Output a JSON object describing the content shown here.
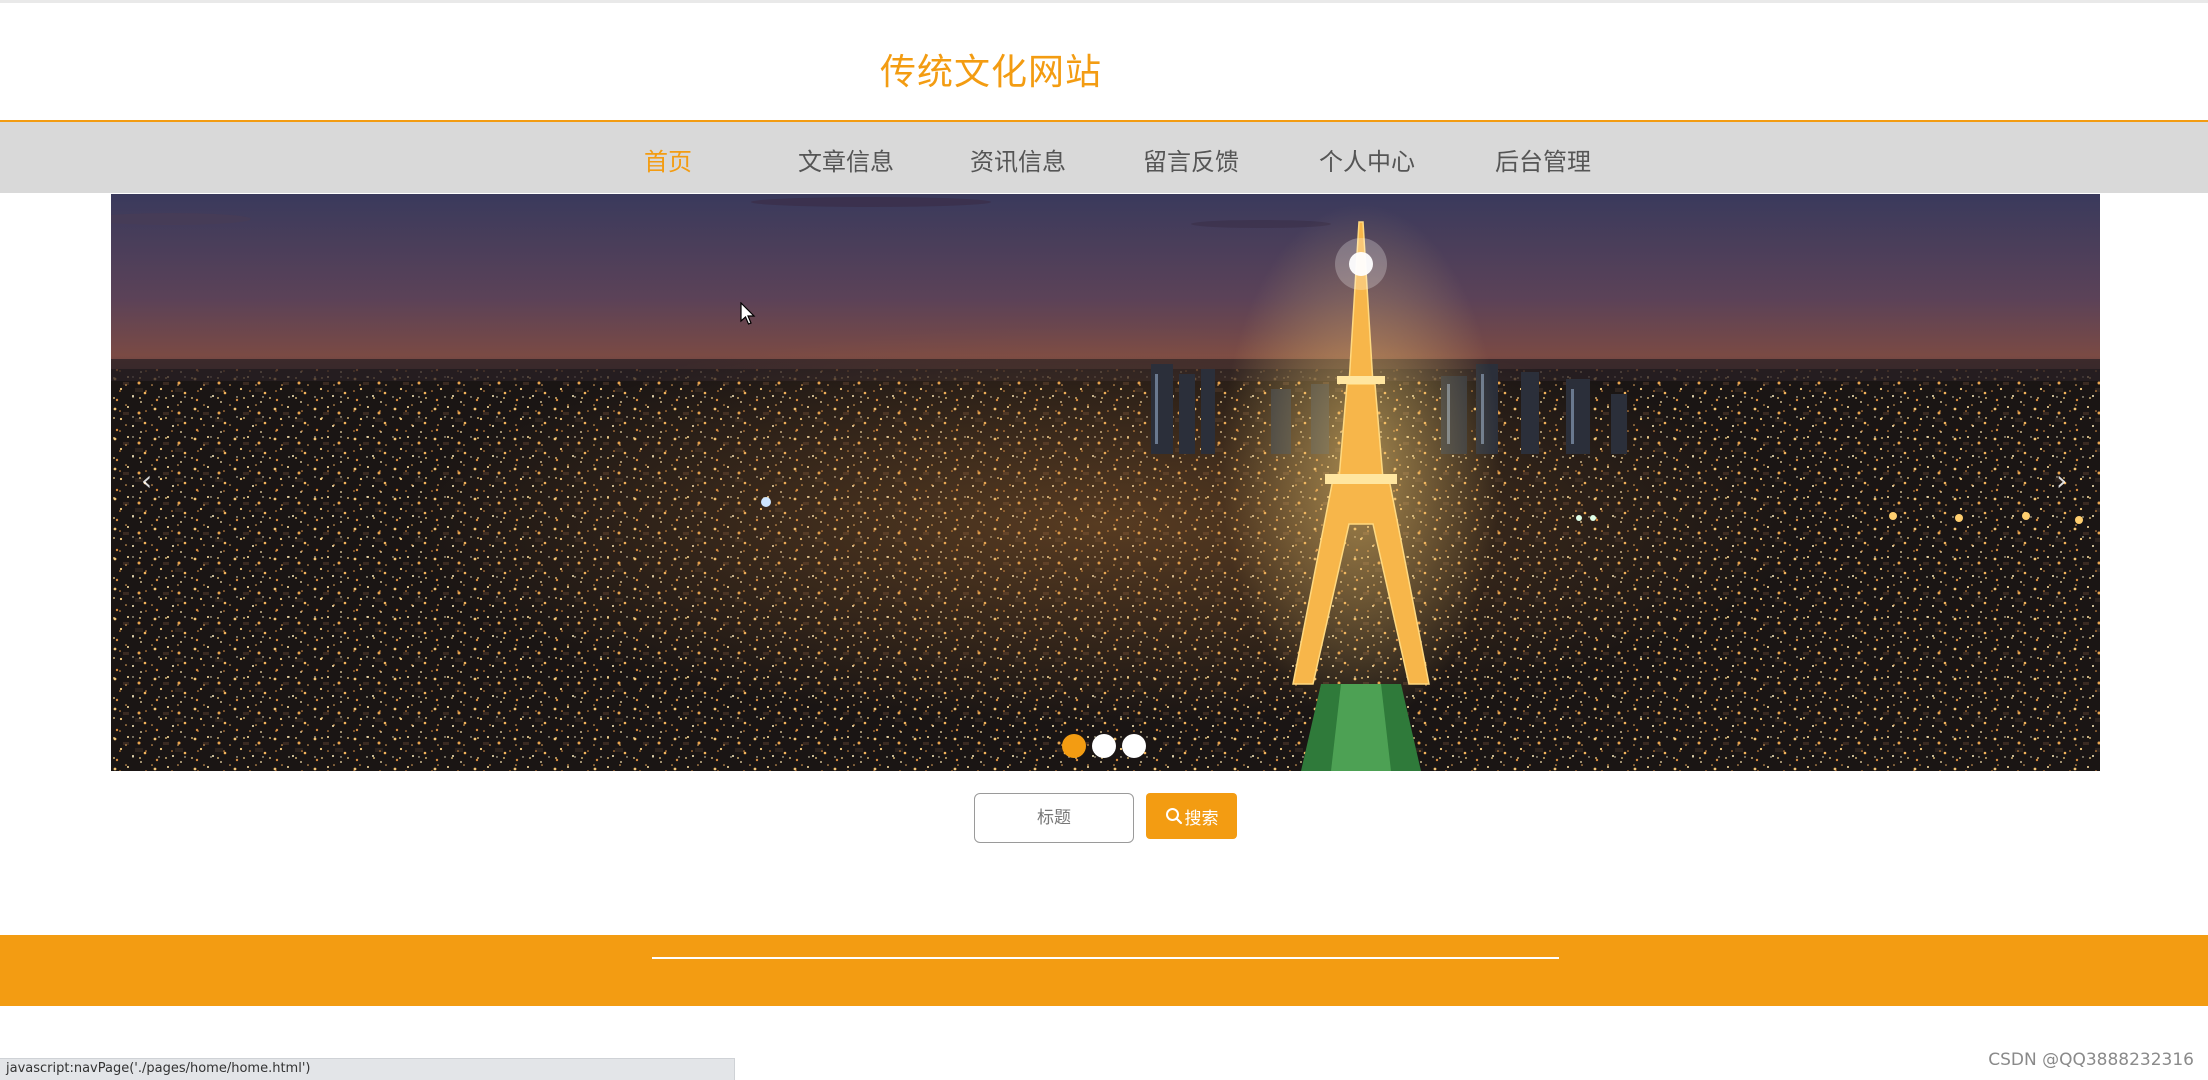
{
  "site": {
    "title": "传统文化网站"
  },
  "nav": {
    "items": [
      {
        "label": "首页",
        "active": true
      },
      {
        "label": "文章信息",
        "active": false
      },
      {
        "label": "资讯信息",
        "active": false
      },
      {
        "label": "留言反馈",
        "active": false
      },
      {
        "label": "个人中心",
        "active": false
      },
      {
        "label": "后台管理",
        "active": false
      }
    ]
  },
  "carousel": {
    "slide_count": 3,
    "active_index": 0,
    "prev_icon": "chevron-left-icon",
    "next_icon": "chevron-right-icon",
    "prev_glyph": "‹",
    "next_glyph": "›"
  },
  "search": {
    "placeholder": "标题",
    "button_label": "搜索",
    "button_icon": "search-icon"
  },
  "statusbar": {
    "url": "javascript:navPage('./pages/home/home.html')"
  },
  "watermark": "CSDN @QQ3888232316",
  "colors": {
    "accent": "#f39c12",
    "nav_bg": "#d9d9d9",
    "footer_bg": "#f39c12"
  }
}
